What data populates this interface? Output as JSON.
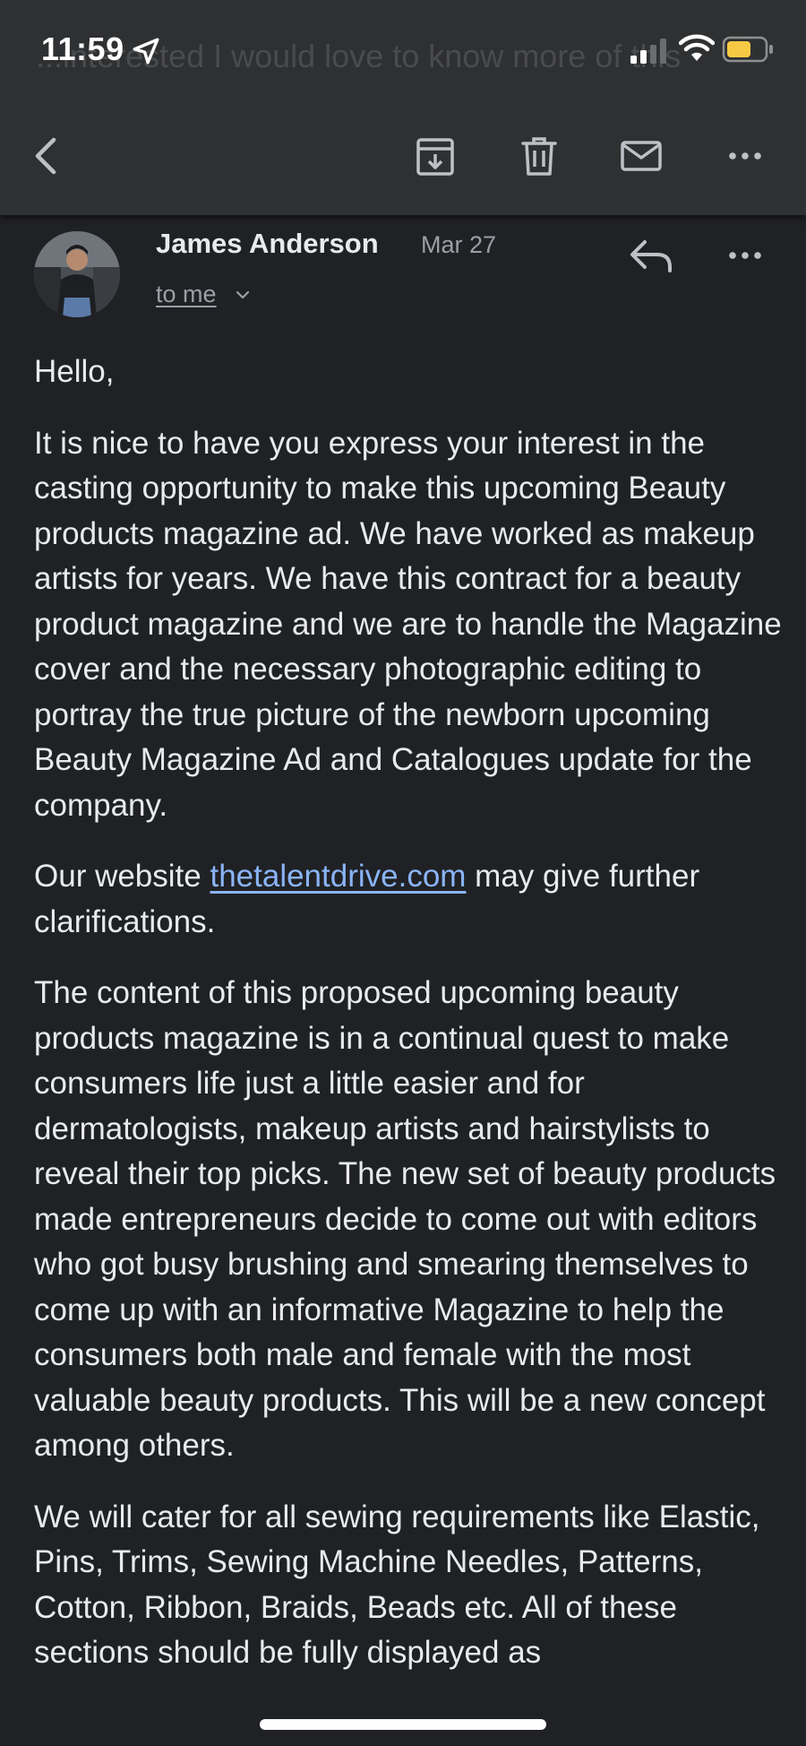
{
  "status_bar": {
    "time": "11:59"
  },
  "ghost_subject": "...interested I would love to know more of this",
  "toolbar": {
    "icons": [
      "back-icon",
      "archive-icon",
      "trash-icon",
      "mail-icon",
      "more-icon"
    ]
  },
  "message": {
    "sender": "James Anderson",
    "date": "Mar 27",
    "recipient": "to me",
    "paragraphs": {
      "greeting": "Hello,",
      "p1": "It is nice to have you express your interest in the casting opportunity to make this upcoming Beauty products magazine ad. We have worked as makeup artists for years. We have this contract for a beauty product magazine and we are to handle the Magazine cover and the necessary photographic editing to portray the true picture of the newborn upcoming Beauty Magazine Ad and Catalogues update for the company.",
      "p2_before": "Our website ",
      "p2_link": "thetalentdrive.com",
      "p2_after": " may give further clarifications.",
      "p3": "The content of this proposed upcoming beauty products magazine is in a continual quest to make consumers life just a little easier and for dermatologists, makeup artists and hairstylists to reveal their top picks. The new set of beauty products made entrepreneurs decide to come out with editors who got busy brushing and smearing themselves to come up with an informative Magazine to help the consumers both male and female with the most valuable beauty products. This will be a new concept among others.",
      "p4": "We will cater for all sewing requirements like Elastic, Pins, Trims, Sewing Machine Needles, Patterns, Cotton, Ribbon, Braids, Beads etc. All of these sections should be fully displayed as"
    }
  },
  "colors": {
    "background": "#202124",
    "toolbar": "#2f3032",
    "text": "#e8eaed",
    "secondary_text": "#9aa0a6",
    "link": "#8ab4f8",
    "battery": "#f6c945"
  }
}
